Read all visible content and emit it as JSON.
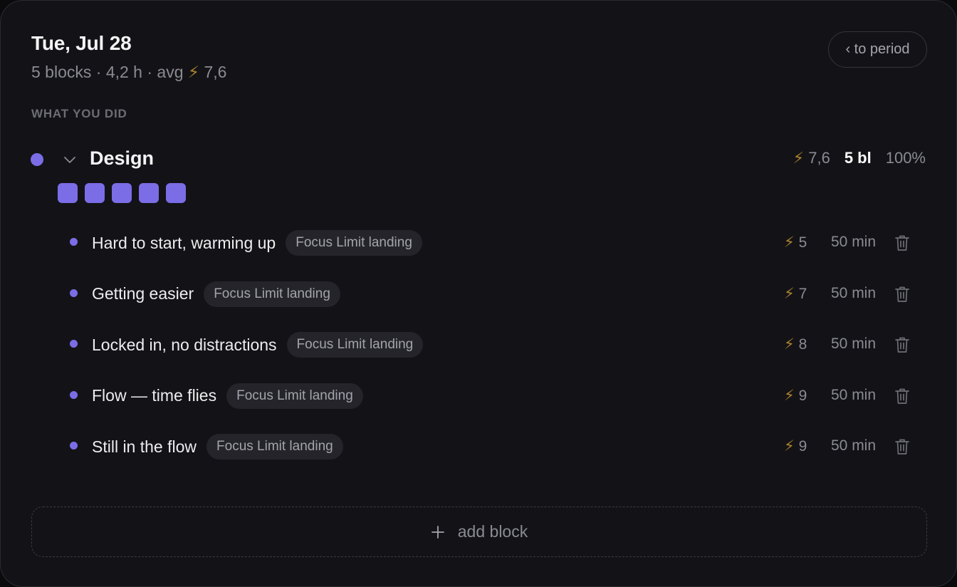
{
  "header": {
    "date": "Tue, Jul 28",
    "summary_prefix": "5 blocks · 4,2 h · avg",
    "summary_bolt": "⚡",
    "summary_avg": "7,6",
    "back_button": "‹ to period"
  },
  "section_label": "WHAT YOU DID",
  "category": {
    "name": "Design",
    "color": "#7b6de6",
    "bolt": "⚡",
    "avg_score": "7,6",
    "block_count": "5 bl",
    "percent": "100%",
    "expanded": true,
    "squares": 5
  },
  "blocks": [
    {
      "label": "Hard to start, warming up",
      "tag": "Focus Limit landing",
      "score": "5",
      "duration": "50 min"
    },
    {
      "label": "Getting easier",
      "tag": "Focus Limit landing",
      "score": "7",
      "duration": "50 min"
    },
    {
      "label": "Locked in, no distractions",
      "tag": "Focus Limit landing",
      "score": "8",
      "duration": "50 min"
    },
    {
      "label": "Flow — time flies",
      "tag": "Focus Limit landing",
      "score": "9",
      "duration": "50 min"
    },
    {
      "label": "Still in the flow",
      "tag": "Focus Limit landing",
      "score": "9",
      "duration": "50 min"
    }
  ],
  "add_block_label": "add block",
  "icons": {
    "bolt": "lightning-bolt-icon",
    "chevron": "chevron-down-icon",
    "trash": "trash-icon",
    "plus": "plus-icon"
  }
}
